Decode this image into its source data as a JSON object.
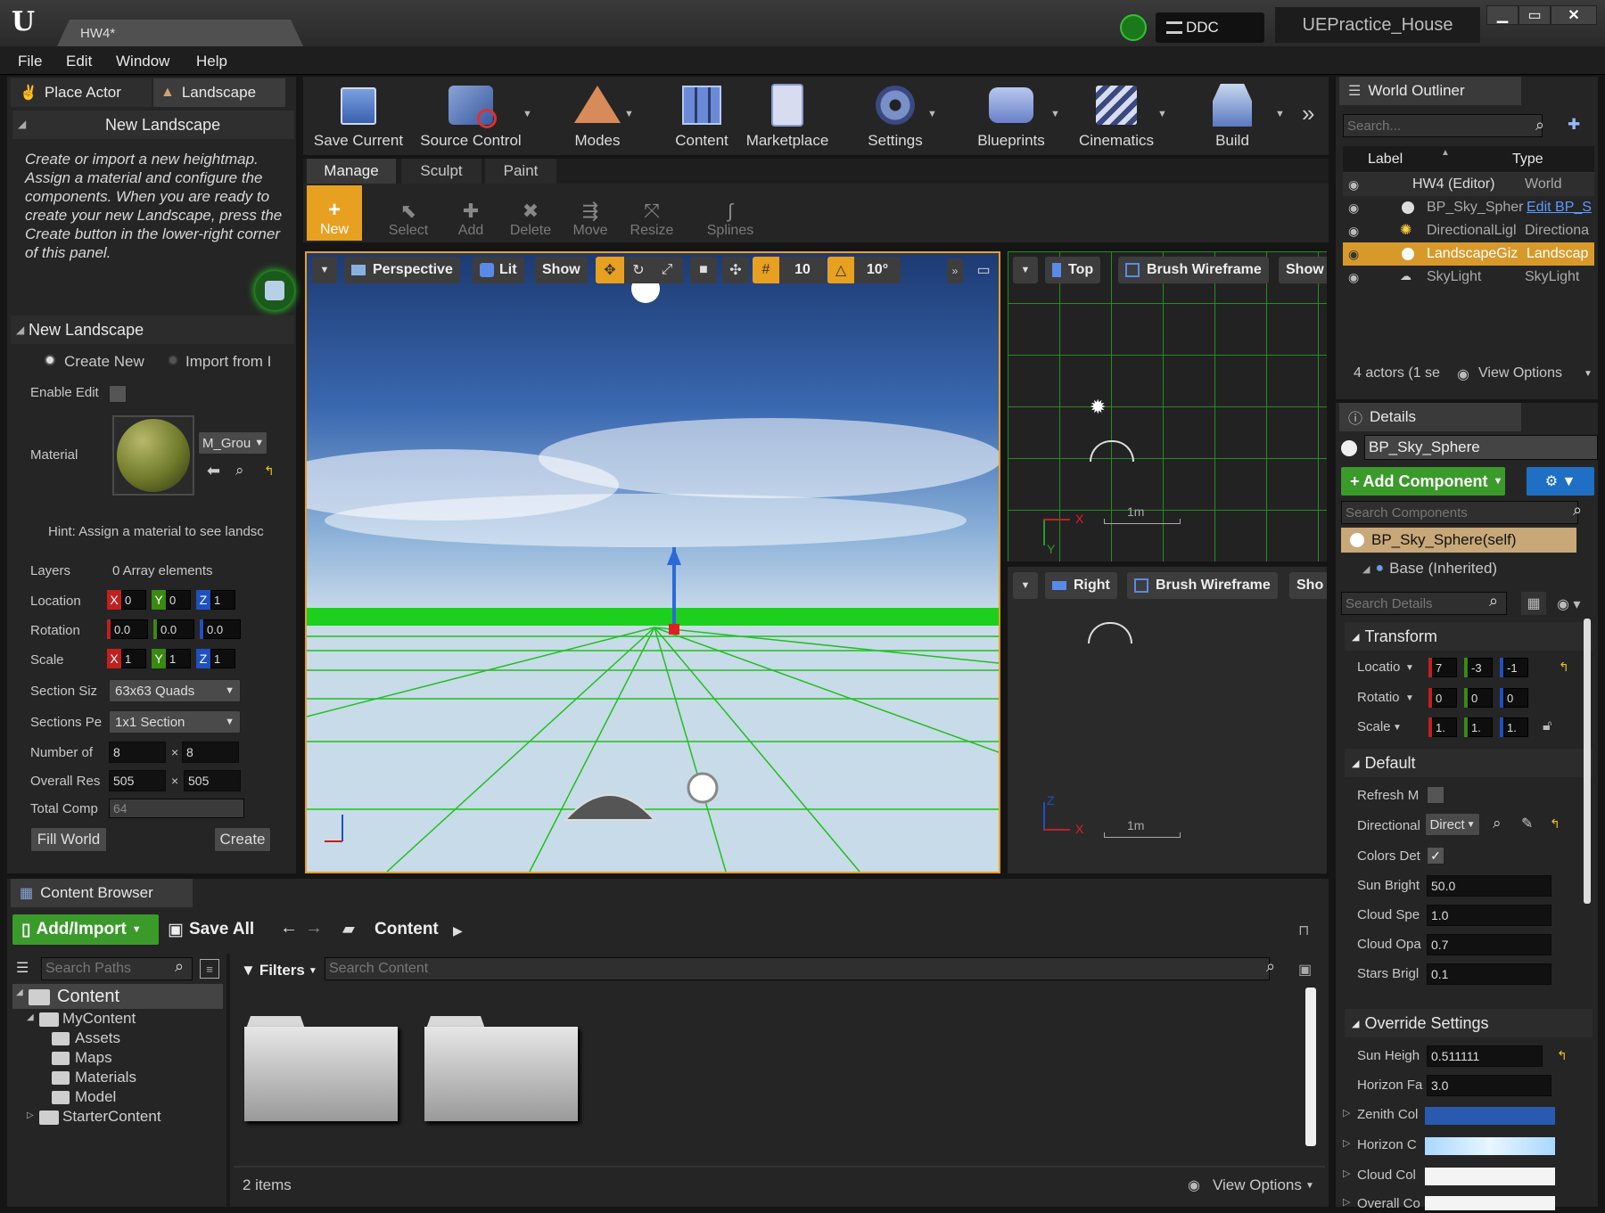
{
  "window": {
    "tab": "HW4*",
    "project": "UEPractice_House",
    "ddc": "DDC"
  },
  "menu": [
    "File",
    "Edit",
    "Window",
    "Help"
  ],
  "mode_tabs": {
    "place_actor": "Place Actor",
    "landscape": "Landscape"
  },
  "landscape_panel": {
    "title": "New Landscape",
    "description": "Create or import a new heightmap. Assign a material and configure the components.  When you are ready to create your new Landscape, press the Create button in the lower-right corner of this panel.",
    "section_title": "New Landscape",
    "create_new": "Create New",
    "import_from": "Import from I",
    "enable_edit": "Enable Edit I",
    "material_label": "Material",
    "material_value": "M_Grou",
    "hint": "Hint: Assign a material to see landsc",
    "layers_label": "Layers",
    "layers_value": "0 Array elements",
    "location_label": "Location",
    "rotation_label": "Rotation",
    "scale_label": "Scale",
    "loc_x": "0",
    "loc_y": "0",
    "loc_z": "1",
    "rot_x": "0.0",
    "rot_y": "0.0",
    "rot_z": "0.0",
    "scale_x": "1",
    "scale_y": "1",
    "scale_z": "1",
    "section_size_label": "Section Siz",
    "section_size_value": "63x63 Quads",
    "sections_per_label": "Sections Pe",
    "sections_per_value": "1x1 Section",
    "number_of_label": "Number of",
    "number_x": "8",
    "number_y": "8",
    "overall_res_label": "Overall Res",
    "overall_x": "505",
    "overall_y": "505",
    "total_comp_label": "Total Comp",
    "total_comp_value": "64",
    "fill_world": "Fill World",
    "create": "Create"
  },
  "toolbar": {
    "save_current": "Save Current",
    "source_control": "Source Control",
    "modes": "Modes",
    "content": "Content",
    "marketplace": "Marketplace",
    "settings": "Settings",
    "blueprints": "Blueprints",
    "cinematics": "Cinematics",
    "build": "Build"
  },
  "landscape_tools": {
    "tabs": [
      "Manage",
      "Sculpt",
      "Paint"
    ],
    "new": "New",
    "select": "Select",
    "add": "Add",
    "delete": "Delete",
    "move": "Move",
    "resize": "Resize",
    "splines": "Splines"
  },
  "viewport_main": {
    "perspective": "Perspective",
    "lit": "Lit",
    "show": "Show",
    "grid_snap": "10",
    "rot_snap": "10°"
  },
  "viewport_top": {
    "view": "Top",
    "mode": "Brush Wireframe",
    "show": "Show",
    "scale": "1m"
  },
  "viewport_right": {
    "view": "Right",
    "mode": "Brush Wireframe",
    "show": "Sho",
    "scale": "1m"
  },
  "outliner": {
    "title": "World Outliner",
    "search_placeholder": "Search...",
    "col_label": "Label",
    "col_type": "Type",
    "rows": [
      {
        "label": "HW4 (Editor)",
        "type": "World"
      },
      {
        "label": "BP_Sky_Spher",
        "type": "Edit BP_S"
      },
      {
        "label": "DirectionalLigl",
        "type": "Directiona"
      },
      {
        "label": "LandscapeGiz",
        "type": "Landscap"
      },
      {
        "label": "SkyLight",
        "type": "SkyLight"
      }
    ],
    "footer": "4 actors (1 se",
    "view_options": "View Options"
  },
  "details": {
    "title": "Details",
    "object": "BP_Sky_Sphere",
    "add_component": "Add Component",
    "search_components": "Search Components",
    "self_component": "BP_Sky_Sphere(self)",
    "base": "Base (Inherited)",
    "search_details": "Search Details",
    "transform": "Transform",
    "location": "Locatio",
    "rotation": "Rotatio",
    "scale": "Scale",
    "loc_vals": [
      "7",
      "-3",
      "-1"
    ],
    "rot_vals": [
      "0",
      "0",
      "0"
    ],
    "scale_vals": [
      "1.",
      "1.",
      "1."
    ],
    "default": "Default",
    "refresh": "Refresh M",
    "directional": "Directional",
    "directional_value": "Direct",
    "colors_det": "Colors Det",
    "sun_bright": "Sun Bright",
    "sun_bright_value": "50.0",
    "cloud_speed": "Cloud Spe",
    "cloud_speed_value": "1.0",
    "cloud_opacity": "Cloud Opa",
    "cloud_opacity_value": "0.7",
    "stars_bright": "Stars Brigl",
    "stars_bright_value": "0.1",
    "override": "Override Settings",
    "sun_height": "Sun Heigh",
    "sun_height_value": "0.511111",
    "horizon_falloff": "Horizon Fa",
    "horizon_falloff_value": "3.0",
    "zenith_color": "Zenith Col",
    "horizon_color": "Horizon C",
    "cloud_color": "Cloud Col",
    "overall_color": "Overall Co"
  },
  "content_browser": {
    "title": "Content Browser",
    "add_import": "Add/Import",
    "save_all": "Save All",
    "path": "Content",
    "search_paths": "Search Paths",
    "filters": "Filters",
    "search_content": "Search Content",
    "tree": {
      "root": "Content",
      "mycontent": "MyContent",
      "assets": "Assets",
      "maps": "Maps",
      "materials": "Materials",
      "model": "Model",
      "starter": "StarterContent"
    },
    "items_count": "2 items",
    "view_options": "View Options"
  },
  "colors": {
    "accent": "#e8a020",
    "add_green": "#3a9a2a",
    "selected": "#d79a2a",
    "blue_btn": "#1f6fc4"
  }
}
